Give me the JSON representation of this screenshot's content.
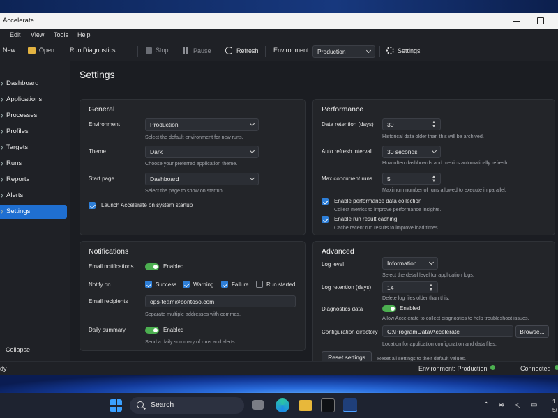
{
  "window": {
    "title": "Accelerate"
  },
  "menu": [
    "Edit",
    "View",
    "Tools",
    "Help"
  ],
  "toolbar": {
    "new": "New",
    "open": "Open",
    "run_diagnostics": "Run Diagnostics",
    "stop": "Stop",
    "pause": "Pause",
    "refresh": "Refresh",
    "environment_label": "Environment:",
    "environment_value": "Production",
    "settings": "Settings"
  },
  "sidebar": {
    "items": [
      "Dashboard",
      "Applications",
      "Processes",
      "Profiles",
      "Targets",
      "Runs",
      "Reports",
      "Alerts",
      "Settings"
    ],
    "active": "Settings",
    "collapse": "Collapse"
  },
  "page": {
    "title": "Settings"
  },
  "general": {
    "title": "General",
    "environment": {
      "label": "Environment",
      "value": "Production",
      "hint": "Select the default environment for new runs."
    },
    "theme": {
      "label": "Theme",
      "value": "Dark",
      "hint": "Choose your preferred application theme."
    },
    "start_page": {
      "label": "Start page",
      "value": "Dashboard",
      "hint": "Select the page to show on startup."
    },
    "launch_on_startup": {
      "label": "Launch Accelerate on system startup",
      "checked": true
    }
  },
  "performance": {
    "title": "Performance",
    "retention": {
      "label": "Data retention (days)",
      "value": "30",
      "hint": "Historical data older than this will be archived."
    },
    "refresh": {
      "label": "Auto refresh interval",
      "value": "30 seconds",
      "hint": "How often dashboards and metrics automatically refresh."
    },
    "concurrent": {
      "label": "Max concurrent runs",
      "value": "5",
      "hint": "Maximum number of runs allowed to execute in parallel."
    },
    "perf_collection": {
      "label": "Enable performance data collection",
      "hint": "Collect metrics to improve performance insights.",
      "checked": true
    },
    "caching": {
      "label": "Enable run result caching",
      "hint": "Cache recent run results to improve load times.",
      "checked": true
    }
  },
  "notifications": {
    "title": "Notifications",
    "email": {
      "label": "Email notifications",
      "state": "Enabled",
      "on": true
    },
    "notify_on": {
      "label": "Notify on",
      "options": [
        {
          "label": "Success",
          "checked": true
        },
        {
          "label": "Warning",
          "checked": true
        },
        {
          "label": "Failure",
          "checked": true
        },
        {
          "label": "Run started",
          "checked": false
        }
      ]
    },
    "recipients": {
      "label": "Email recipients",
      "value": "ops-team@contoso.com",
      "hint": "Separate multiple addresses with commas."
    },
    "daily": {
      "label": "Daily summary",
      "state": "Enabled",
      "hint": "Send a daily summary of runs and alerts.",
      "on": true
    }
  },
  "advanced": {
    "title": "Advanced",
    "log_level": {
      "label": "Log level",
      "value": "Information",
      "hint": "Select the detail level for application logs."
    },
    "log_retention": {
      "label": "Log retention (days)",
      "value": "14",
      "hint": "Delete log files older than this."
    },
    "diagnostics": {
      "label": "Diagnostics data",
      "state": "Enabled",
      "hint": "Allow Accelerate to collect diagnostics to help troubleshoot issues.",
      "on": true
    },
    "config_dir": {
      "label": "Configuration directory",
      "value": "C:\\ProgramData\\Accelerate",
      "browse": "Browse...",
      "hint": "Location for application configuration and data files."
    },
    "reset": {
      "button": "Reset settings",
      "hint": "Reset all settings to their default values."
    }
  },
  "statusbar": {
    "left": "dy",
    "environment": "Environment: Production",
    "connection": "Connected"
  },
  "taskbar": {
    "search": "Search",
    "clock_top": "1",
    "clock_bottom": "5/"
  },
  "colors": {
    "accent": "#1f6fd1",
    "toggle_on": "#4caf50",
    "status_ok": "#4caf50"
  }
}
